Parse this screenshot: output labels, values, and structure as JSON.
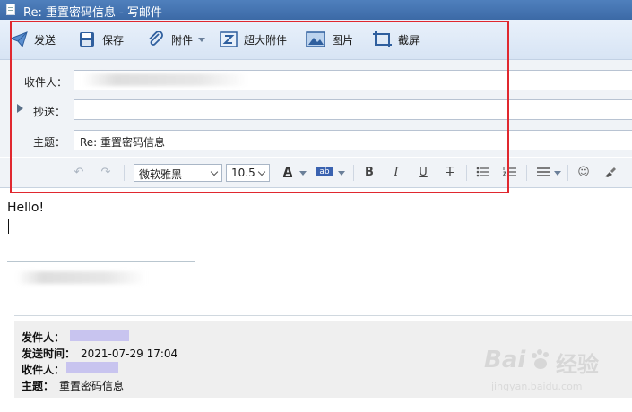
{
  "window": {
    "title": "Re: 重置密码信息 - 写邮件"
  },
  "toolbar": {
    "send": "发送",
    "save": "保存",
    "attach": "附件",
    "big_attach": "超大附件",
    "image": "图片",
    "screenshot": "截屏"
  },
  "compose": {
    "to_label": "收件人：",
    "cc_label": "抄送：",
    "subject_label": "主题：",
    "to_value": "",
    "cc_value": "",
    "subject_value": "Re: 重置密码信息"
  },
  "format": {
    "font_family": "微软雅黑",
    "font_size": "10.5"
  },
  "body": {
    "text": "Hello!"
  },
  "quoted": {
    "from_label": "发件人：",
    "from_value": "",
    "time_label": "发送时间：",
    "time_value": "2021-07-29 17:04",
    "to_label": "收件人：",
    "to_value": "",
    "subject_label": "主题：",
    "subject_value": "重置密码信息"
  },
  "watermark": {
    "brand": "Bai",
    "brand2": "经验",
    "url": "jingyan.baidu.com"
  },
  "colors": {
    "accent": "#3c6aa6",
    "highlight_box": "#e0282f"
  }
}
